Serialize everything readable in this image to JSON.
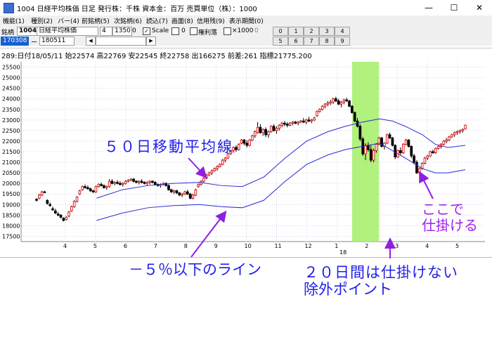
{
  "window": {
    "title": "1004 日経平均株価  日足     発行株：千株  資本金：百万  売買単位（株）：1000",
    "minimize": "—",
    "maximize": "☐",
    "close": "✕"
  },
  "menu": [
    "機能(1)",
    "種別(2)",
    "バー(4)",
    "前銘柄(5)",
    "次銘柄(6)",
    "読込(7)",
    "画面(8)",
    "信用残(9)",
    "表示期間(0)"
  ],
  "toolbar": {
    "code_label": "銘柄",
    "code_value": "1004",
    "name_value": "日経平均株価",
    "count_value": "4",
    "pos_value": "1350",
    "pos_suffix": "0",
    "scale_checked": "✓",
    "scale_label": "Scale",
    "zero_value": "0",
    "margin_label": "権利落",
    "x1000_label": "×1000",
    "badge": "0",
    "date_from": "170308",
    "dash": "ー",
    "date_to": "180511",
    "left_arrow": "◀",
    "right_arrow": "▶",
    "num_row1": [
      "0",
      "1",
      "2",
      "3",
      "4"
    ],
    "num_row2": [
      "5",
      "6",
      "7",
      "8",
      "9"
    ]
  },
  "info_line": "289:日付18/05/11  始22574  高22769  安22545  終22758  出166275  前差:261  指標21775.200",
  "chart_data": {
    "type": "candlestick",
    "y_ticks": [
      17500,
      18000,
      18500,
      19000,
      19500,
      20000,
      20500,
      21000,
      21500,
      22000,
      22500,
      23000,
      23500,
      24000,
      24500,
      25000,
      25500
    ],
    "ylim": [
      17250,
      25750
    ],
    "x_ticks": [
      "4",
      "5",
      "6",
      "7",
      "8",
      "9",
      "10",
      "11",
      "12",
      "1",
      "2",
      "3",
      "4",
      "5"
    ],
    "year_label": "18",
    "candles": [
      [
        19250,
        19300,
        19150,
        19200
      ],
      [
        19300,
        19500,
        19250,
        19450
      ],
      [
        19450,
        19650,
        19400,
        19600
      ],
      [
        19600,
        19650,
        19550,
        19580
      ],
      [
        19200,
        19250,
        19000,
        19050
      ],
      [
        19000,
        19100,
        18900,
        18950
      ],
      [
        18800,
        18900,
        18700,
        18750
      ],
      [
        18700,
        18800,
        18550,
        18600
      ],
      [
        18550,
        18650,
        18450,
        18500
      ],
      [
        18500,
        18550,
        18350,
        18400
      ],
      [
        18350,
        18400,
        18200,
        18250
      ],
      [
        18300,
        18450,
        18250,
        18400
      ],
      [
        18450,
        18700,
        18400,
        18650
      ],
      [
        18700,
        18950,
        18650,
        18900
      ],
      [
        18900,
        19200,
        18850,
        19150
      ],
      [
        19150,
        19400,
        19100,
        19350
      ],
      [
        19500,
        19700,
        19450,
        19650
      ],
      [
        19700,
        19900,
        19650,
        19850
      ],
      [
        19850,
        19950,
        19750,
        19800
      ],
      [
        19800,
        19900,
        19700,
        19750
      ],
      [
        19750,
        19800,
        19600,
        19650
      ],
      [
        19650,
        19700,
        19550,
        19600
      ],
      [
        19600,
        19900,
        19550,
        19850
      ],
      [
        19850,
        20000,
        19800,
        19950
      ],
      [
        19950,
        20050,
        19850,
        19900
      ],
      [
        19900,
        19950,
        19750,
        19800
      ],
      [
        19800,
        19900,
        19700,
        19850
      ],
      [
        19850,
        20200,
        19800,
        20100
      ],
      [
        20100,
        20200,
        19950,
        20000
      ],
      [
        20000,
        20100,
        19900,
        20050
      ],
      [
        20050,
        20150,
        19950,
        20000
      ],
      [
        20000,
        20100,
        19900,
        19950
      ],
      [
        19950,
        20050,
        19850,
        20000
      ],
      [
        20000,
        20150,
        19950,
        20100
      ],
      [
        20100,
        20200,
        20050,
        20150
      ],
      [
        20150,
        20250,
        20100,
        20200
      ],
      [
        20200,
        20250,
        20050,
        20100
      ],
      [
        20100,
        20150,
        20000,
        20050
      ],
      [
        20050,
        20150,
        19950,
        20100
      ],
      [
        20100,
        20200,
        20000,
        20050
      ],
      [
        20050,
        20100,
        19950,
        20000
      ],
      [
        20000,
        20100,
        19900,
        20050
      ],
      [
        20050,
        20150,
        19950,
        20100
      ],
      [
        20100,
        20150,
        20000,
        20050
      ],
      [
        20050,
        20100,
        19900,
        19950
      ],
      [
        19950,
        20000,
        19850,
        19900
      ],
      [
        19900,
        20000,
        19800,
        19950
      ],
      [
        19950,
        20050,
        19900,
        20000
      ],
      [
        20000,
        20050,
        19850,
        19900
      ],
      [
        19900,
        19950,
        19650,
        19700
      ],
      [
        19700,
        19750,
        19550,
        19600
      ],
      [
        19600,
        19700,
        19500,
        19650
      ],
      [
        19650,
        19700,
        19500,
        19550
      ],
      [
        19550,
        19600,
        19400,
        19450
      ],
      [
        19450,
        19550,
        19350,
        19500
      ],
      [
        19500,
        19650,
        19450,
        19600
      ],
      [
        19600,
        19700,
        19450,
        19500
      ],
      [
        19500,
        19550,
        19250,
        19300
      ],
      [
        19300,
        19500,
        19250,
        19450
      ],
      [
        19450,
        19750,
        19400,
        19700
      ],
      [
        19850,
        20000,
        19800,
        19950
      ],
      [
        19950,
        20150,
        19900,
        20100
      ],
      [
        20100,
        20300,
        20050,
        20250
      ],
      [
        20250,
        20450,
        20200,
        20400
      ],
      [
        20400,
        20550,
        20350,
        20500
      ],
      [
        20500,
        20650,
        20400,
        20600
      ],
      [
        20600,
        20750,
        20550,
        20700
      ],
      [
        20700,
        20850,
        20600,
        20800
      ],
      [
        20800,
        20950,
        20750,
        20900
      ],
      [
        20900,
        21150,
        20850,
        21100
      ],
      [
        21100,
        21250,
        21000,
        21200
      ],
      [
        21200,
        21450,
        21150,
        21400
      ],
      [
        21400,
        21600,
        21350,
        21550
      ],
      [
        21550,
        21750,
        21450,
        21700
      ],
      [
        21700,
        21800,
        21500,
        21600
      ],
      [
        21600,
        21900,
        21550,
        21850
      ],
      [
        21900,
        22100,
        21850,
        22050
      ],
      [
        22050,
        22100,
        21800,
        21900
      ],
      [
        21900,
        22050,
        21700,
        21800
      ],
      [
        21800,
        22100,
        21750,
        22050
      ],
      [
        22050,
        22300,
        22000,
        22250
      ],
      [
        22250,
        22500,
        22150,
        22450
      ],
      [
        22400,
        22900,
        22350,
        22650
      ],
      [
        22650,
        22800,
        22350,
        22400
      ],
      [
        22400,
        22600,
        22250,
        22550
      ],
      [
        22550,
        22650,
        22200,
        22300
      ],
      [
        22300,
        22500,
        22150,
        22450
      ],
      [
        22450,
        22750,
        22400,
        22700
      ],
      [
        22700,
        22800,
        22450,
        22500
      ],
      [
        22500,
        22700,
        22350,
        22600
      ],
      [
        22600,
        22800,
        22500,
        22750
      ],
      [
        22750,
        22900,
        22650,
        22850
      ],
      [
        22850,
        22950,
        22700,
        22800
      ],
      [
        22800,
        22900,
        22650,
        22750
      ],
      [
        22750,
        22900,
        22700,
        22850
      ],
      [
        22850,
        22950,
        22750,
        22900
      ],
      [
        22900,
        22950,
        22800,
        22850
      ],
      [
        22850,
        22950,
        22750,
        22900
      ],
      [
        22900,
        23000,
        22850,
        22950
      ],
      [
        22950,
        23100,
        22850,
        22900
      ],
      [
        22900,
        23050,
        22800,
        23000
      ],
      [
        23000,
        23150,
        22900,
        22950
      ],
      [
        22950,
        23050,
        22850,
        23000
      ],
      [
        23000,
        23150,
        22950,
        23100
      ],
      [
        23200,
        23450,
        23150,
        23400
      ],
      [
        23400,
        23550,
        23350,
        23500
      ],
      [
        23500,
        23700,
        23450,
        23650
      ],
      [
        23650,
        23800,
        23550,
        23750
      ],
      [
        23750,
        23900,
        23650,
        23800
      ],
      [
        23800,
        23950,
        23700,
        23850
      ],
      [
        23850,
        24050,
        23750,
        24000
      ],
      [
        24000,
        24100,
        23850,
        23900
      ],
      [
        23900,
        24000,
        23700,
        23750
      ],
      [
        23750,
        23900,
        23600,
        23850
      ],
      [
        23850,
        24000,
        23750,
        23950
      ],
      [
        23950,
        24050,
        23850,
        23900
      ],
      [
        23900,
        23950,
        23600,
        23650
      ],
      [
        23650,
        23700,
        23300,
        23350
      ],
      [
        23350,
        23400,
        22900,
        22950
      ],
      [
        22950,
        23100,
        22650,
        22700
      ],
      [
        22700,
        22800,
        22000,
        22100
      ],
      [
        22100,
        22200,
        21300,
        21400
      ],
      [
        21400,
        21900,
        21100,
        21800
      ],
      [
        21800,
        21950,
        21500,
        21600
      ],
      [
        21600,
        21800,
        21000,
        21100
      ],
      [
        21100,
        21650,
        21000,
        21550
      ],
      [
        21550,
        21900,
        21450,
        21850
      ],
      [
        21850,
        22200,
        21800,
        22150
      ],
      [
        22150,
        22200,
        21700,
        21750
      ],
      [
        21750,
        21950,
        21600,
        21900
      ],
      [
        21900,
        22350,
        21850,
        22300
      ],
      [
        22300,
        22400,
        22100,
        22150
      ],
      [
        22150,
        22200,
        21750,
        21800
      ],
      [
        21800,
        21850,
        21150,
        21250
      ],
      [
        21250,
        21600,
        21200,
        21550
      ],
      [
        21550,
        21700,
        21350,
        21450
      ],
      [
        21450,
        21900,
        21400,
        21850
      ],
      [
        21850,
        22100,
        21800,
        22050
      ],
      [
        22050,
        22100,
        21700,
        21750
      ],
      [
        21750,
        21800,
        21200,
        21300
      ],
      [
        21300,
        21400,
        20900,
        21000
      ],
      [
        21000,
        21100,
        20450,
        20500
      ],
      [
        20500,
        20750,
        20400,
        20700
      ],
      [
        20700,
        21000,
        20650,
        20950
      ],
      [
        20950,
        21250,
        20900,
        21200
      ],
      [
        21200,
        21350,
        21100,
        21300
      ],
      [
        21300,
        21550,
        21250,
        21500
      ],
      [
        21500,
        21600,
        21400,
        21450
      ],
      [
        21450,
        21700,
        21400,
        21650
      ],
      [
        21650,
        21800,
        21600,
        21750
      ],
      [
        21750,
        21900,
        21650,
        21850
      ],
      [
        21850,
        22050,
        21800,
        22000
      ],
      [
        22000,
        22150,
        21900,
        22050
      ],
      [
        22050,
        22250,
        22000,
        22200
      ],
      [
        22200,
        22350,
        22150,
        22300
      ],
      [
        22300,
        22450,
        22200,
        22400
      ],
      [
        22400,
        22500,
        22300,
        22450
      ],
      [
        22450,
        22550,
        22350,
        22500
      ],
      [
        22500,
        22600,
        22400,
        22550
      ],
      [
        22574,
        22769,
        22545,
        22758
      ]
    ],
    "ma_line": [
      [
        0.07,
        null
      ],
      [
        0.14,
        19300
      ],
      [
        0.2,
        19700
      ],
      [
        0.26,
        19900
      ],
      [
        0.32,
        20000
      ],
      [
        0.38,
        20050
      ],
      [
        0.43,
        19900
      ],
      [
        0.48,
        19850
      ],
      [
        0.53,
        20300
      ],
      [
        0.58,
        21200
      ],
      [
        0.63,
        22000
      ],
      [
        0.68,
        22450
      ],
      [
        0.72,
        22700
      ],
      [
        0.76,
        22900
      ],
      [
        0.8,
        23050
      ],
      [
        0.83,
        22950
      ],
      [
        0.86,
        22700
      ],
      [
        0.9,
        22300
      ],
      [
        0.93,
        21850
      ],
      [
        0.96,
        21700
      ],
      [
        1.0,
        21800
      ]
    ],
    "lower_line": [
      [
        0.07,
        null
      ],
      [
        0.14,
        18250
      ],
      [
        0.2,
        18600
      ],
      [
        0.26,
        18850
      ],
      [
        0.32,
        18950
      ],
      [
        0.38,
        19000
      ],
      [
        0.43,
        18900
      ],
      [
        0.48,
        18850
      ],
      [
        0.53,
        19200
      ],
      [
        0.58,
        20100
      ],
      [
        0.63,
        20900
      ],
      [
        0.68,
        21350
      ],
      [
        0.72,
        21600
      ],
      [
        0.76,
        21750
      ],
      [
        0.8,
        21900
      ],
      [
        0.83,
        21550
      ],
      [
        0.86,
        21200
      ],
      [
        0.9,
        20700
      ],
      [
        0.93,
        20500
      ],
      [
        0.96,
        20500
      ],
      [
        1.0,
        20650
      ]
    ],
    "highlight_range": [
      117,
      127
    ]
  },
  "annotations": {
    "ma_label": "５０日移動平均線",
    "lower_label": "－５％以下のライン",
    "exclusion_line1": "２０日間は仕掛けない",
    "exclusion_line2": "除外ポイント",
    "entry_line1": "ここで",
    "entry_line2": "仕掛ける"
  }
}
